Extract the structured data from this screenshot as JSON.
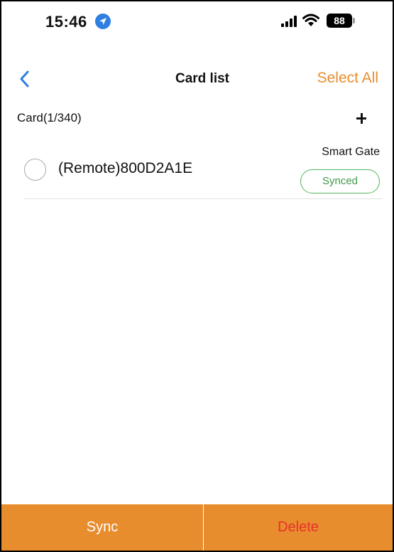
{
  "status_bar": {
    "time": "15:46",
    "battery": "88",
    "icons": [
      "location-arrow-icon",
      "signal-icon",
      "wifi-icon",
      "battery-icon"
    ]
  },
  "nav": {
    "title": "Card list",
    "select_all": "Select All",
    "back_icon": "chevron-left-icon"
  },
  "card_header": {
    "count_label": "Card(1/340)",
    "add_icon": "plus-icon"
  },
  "cards": [
    {
      "name": "(Remote)800D2A1E",
      "type": "Smart Gate",
      "status": "Synced",
      "selected": false
    }
  ],
  "bottom_bar": {
    "sync_label": "Sync",
    "delete_label": "Delete"
  },
  "colors": {
    "accent": "#e88d2e",
    "delete": "#e8302c",
    "synced": "#52b65b",
    "back": "#2f7fe0"
  }
}
